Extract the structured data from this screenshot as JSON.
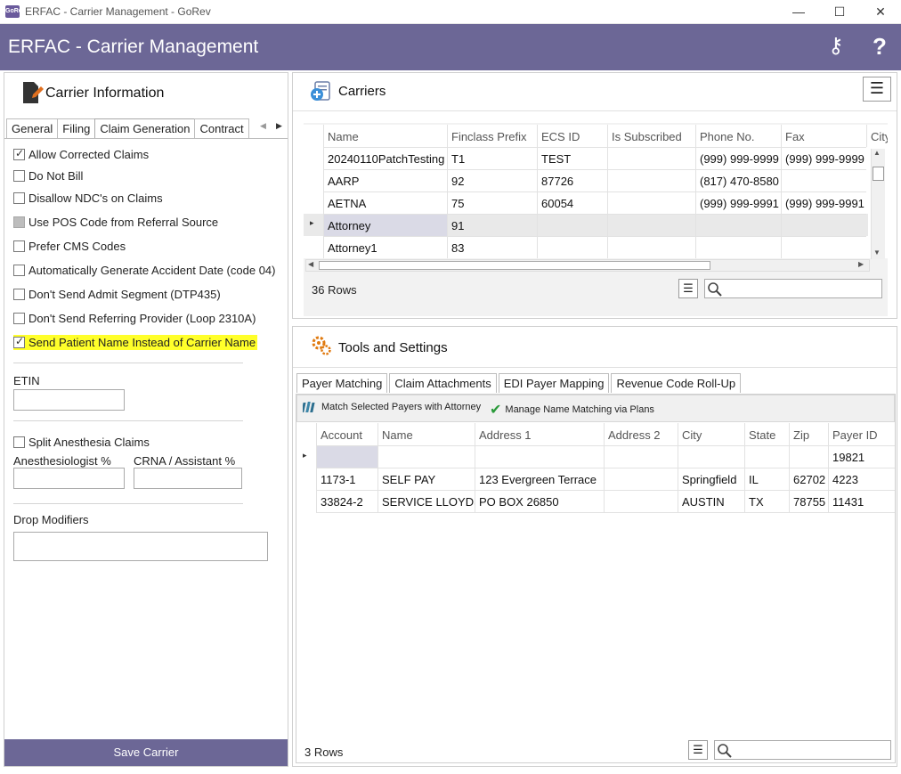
{
  "window": {
    "title": "ERFAC - Carrier Management - GoRev",
    "app_icon": "GoRev",
    "min": "—",
    "max": "☐",
    "close": "✕"
  },
  "header": {
    "title": "ERFAC - Carrier Management",
    "keys_icon": "⚷",
    "help_icon": "?"
  },
  "carrier_info": {
    "title": "Carrier Information",
    "tabs": [
      "General",
      "Filing",
      "Claim Generation",
      "Contract"
    ],
    "active_tab": "Claim Generation",
    "checkboxes": [
      {
        "label": "Allow Corrected Claims",
        "checked": true
      },
      {
        "label": "Do Not Bill",
        "checked": false
      },
      {
        "label": "Disallow NDC's on Claims",
        "checked": false
      },
      {
        "label": "Use POS Code from Referral Source",
        "checked": false,
        "indeterminate": true
      },
      {
        "label": "Prefer CMS Codes",
        "checked": false
      },
      {
        "label": "Automatically Generate Accident Date (code 04)",
        "checked": false
      },
      {
        "label": "Don't Send Admit Segment (DTP435)",
        "checked": false
      },
      {
        "label": "Don't Send Referring Provider (Loop 2310A)",
        "checked": false
      },
      {
        "label": "Send Patient Name Instead of Carrier Name",
        "checked": true,
        "highlighted": true
      }
    ],
    "etin_label": "ETIN",
    "etin_value": "",
    "split_anesthesia_label": "Split Anesthesia Claims",
    "anesthesiologist_label": "Anesthesiologist %",
    "crna_label": "CRNA / Assistant %",
    "drop_modifiers_label": "Drop Modifiers",
    "save_label": "Save Carrier"
  },
  "carriers": {
    "title": "Carriers",
    "columns": [
      "Name",
      "Finclass Prefix",
      "ECS ID",
      "Is Subscribed",
      "Phone No.",
      "Fax",
      "City"
    ],
    "rows": [
      [
        "20240110PatchTesting",
        "T1",
        "TEST",
        "",
        "(999) 999-9999",
        "(999) 999-9999",
        ""
      ],
      [
        "AARP",
        "92",
        "87726",
        "",
        "(817) 470-8580",
        "",
        ""
      ],
      [
        "AETNA",
        "75",
        "60054",
        "",
        "(999) 999-9991",
        "(999) 999-9991",
        ""
      ],
      [
        "Attorney",
        "91",
        "",
        "",
        "",
        "",
        ""
      ],
      [
        "Attorney1",
        "83",
        "",
        "",
        "",
        "",
        ""
      ]
    ],
    "selected_row": 3,
    "row_count": "36 Rows"
  },
  "tools": {
    "title": "Tools and Settings",
    "tabs": [
      "Payer Matching",
      "Claim Attachments",
      "EDI Payer Mapping",
      "Revenue Code Roll-Up"
    ],
    "active_tab": "Payer Matching",
    "toolbar": {
      "match_label": "Match Selected Payers with Attorney",
      "manage_label": "Manage Name Matching via Plans"
    },
    "columns": [
      "Account",
      "Name",
      "Address 1",
      "Address 2",
      "City",
      "State",
      "Zip",
      "Payer ID"
    ],
    "rows": [
      [
        "",
        "",
        "",
        "",
        "",
        "",
        "",
        "19821"
      ],
      [
        "1173-1",
        "SELF PAY",
        "123 Evergreen Terrace",
        "",
        "Springfield",
        "IL",
        "62702",
        "4223"
      ],
      [
        "33824-2",
        "SERVICE LLOYDS",
        "PO BOX 26850",
        "",
        "AUSTIN",
        "TX",
        "78755",
        "11431"
      ]
    ],
    "row_count": "3 Rows"
  },
  "colors": {
    "accent": "#6c6796",
    "highlight": "#ffff2a",
    "selection": "#dadae6"
  }
}
